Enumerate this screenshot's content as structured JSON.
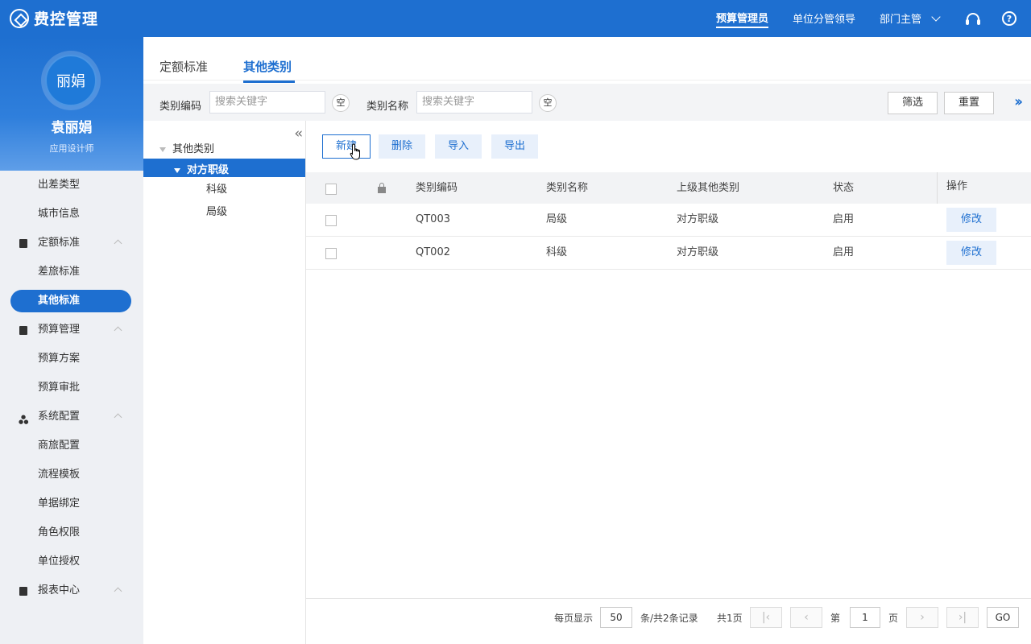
{
  "header": {
    "app_title": "费控管理",
    "nav": [
      "预算管理员",
      "单位分管领导",
      "部门主管"
    ],
    "help_symbol": "?"
  },
  "profile": {
    "avatar_text": "丽娟",
    "name": "袁丽娟",
    "role": "应用设计师"
  },
  "sidebar": {
    "items_top": [
      "出差类型",
      "城市信息"
    ],
    "group_quota": "定额标准",
    "items_quota": [
      "差旅标准",
      "其他标准"
    ],
    "group_budget": "预算管理",
    "items_budget": [
      "预算方案",
      "预算审批"
    ],
    "group_system": "系统配置",
    "items_system": [
      "商旅配置",
      "流程模板",
      "单据绑定",
      "角色权限",
      "单位授权"
    ],
    "group_report": "报表中心"
  },
  "tabs": [
    "定额标准",
    "其他类别"
  ],
  "filter": {
    "code_label": "类别编码",
    "code_placeholder": "搜索关键字",
    "name_label": "类别名称",
    "name_placeholder": "搜索关键字",
    "clear_label": "空",
    "filter_btn": "筛选",
    "reset_btn": "重置"
  },
  "tree": {
    "root": "其他类别",
    "selected": "对方职级",
    "children": [
      "科级",
      "局级"
    ]
  },
  "toolbar": [
    "新建",
    "删除",
    "导入",
    "导出"
  ],
  "table": {
    "headers": [
      "类别编码",
      "类别名称",
      "上级其他类别",
      "状态",
      "操作"
    ],
    "rows": [
      {
        "code": "QT003",
        "name": "局级",
        "parent": "对方职级",
        "status": "启用",
        "action": "修改"
      },
      {
        "code": "QT002",
        "name": "科级",
        "parent": "对方职级",
        "status": "启用",
        "action": "修改"
      }
    ]
  },
  "pagination": {
    "per_page_label": "每页显示",
    "per_page": "50",
    "records_text": "条/共2条记录",
    "total_pages_text": "共1页",
    "page_prefix": "第",
    "current_page": "1",
    "page_suffix": "页",
    "go": "GO"
  },
  "colors": {
    "primary": "#1e6fd0",
    "sidebar_bg": "#eef0f4"
  }
}
